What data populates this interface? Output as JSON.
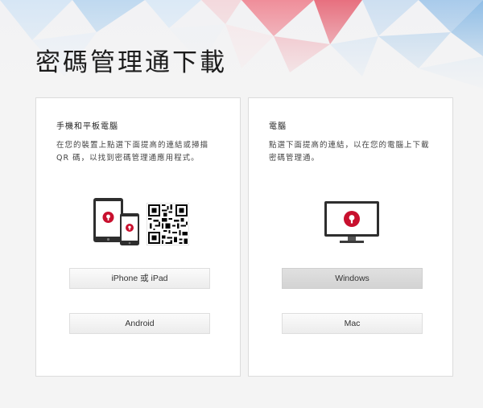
{
  "page": {
    "title": "密碼管理通下載"
  },
  "mobile_panel": {
    "heading": "手機和平板電腦",
    "description": "在您的裝置上點選下面提高的連結或掃描 QR 碼，以找到密碼管理通應用程式。",
    "buttons": {
      "ios": "iPhone 或 iPad",
      "android": "Android"
    }
  },
  "desktop_panel": {
    "heading": "電腦",
    "description": "點選下面提高的連結，以在您的電腦上下載密碼管理通。",
    "buttons": {
      "windows": "Windows",
      "mac": "Mac"
    }
  },
  "icons": {
    "devices": "tablet-and-phone-icon",
    "qr": "qr-code-icon",
    "monitor": "desktop-monitor-icon",
    "brand_logo": "password-manager-logo-icon"
  },
  "colors": {
    "brand_red": "#c8102e",
    "button_active": "#d6d6d6",
    "panel_border": "#dcdcdc"
  }
}
